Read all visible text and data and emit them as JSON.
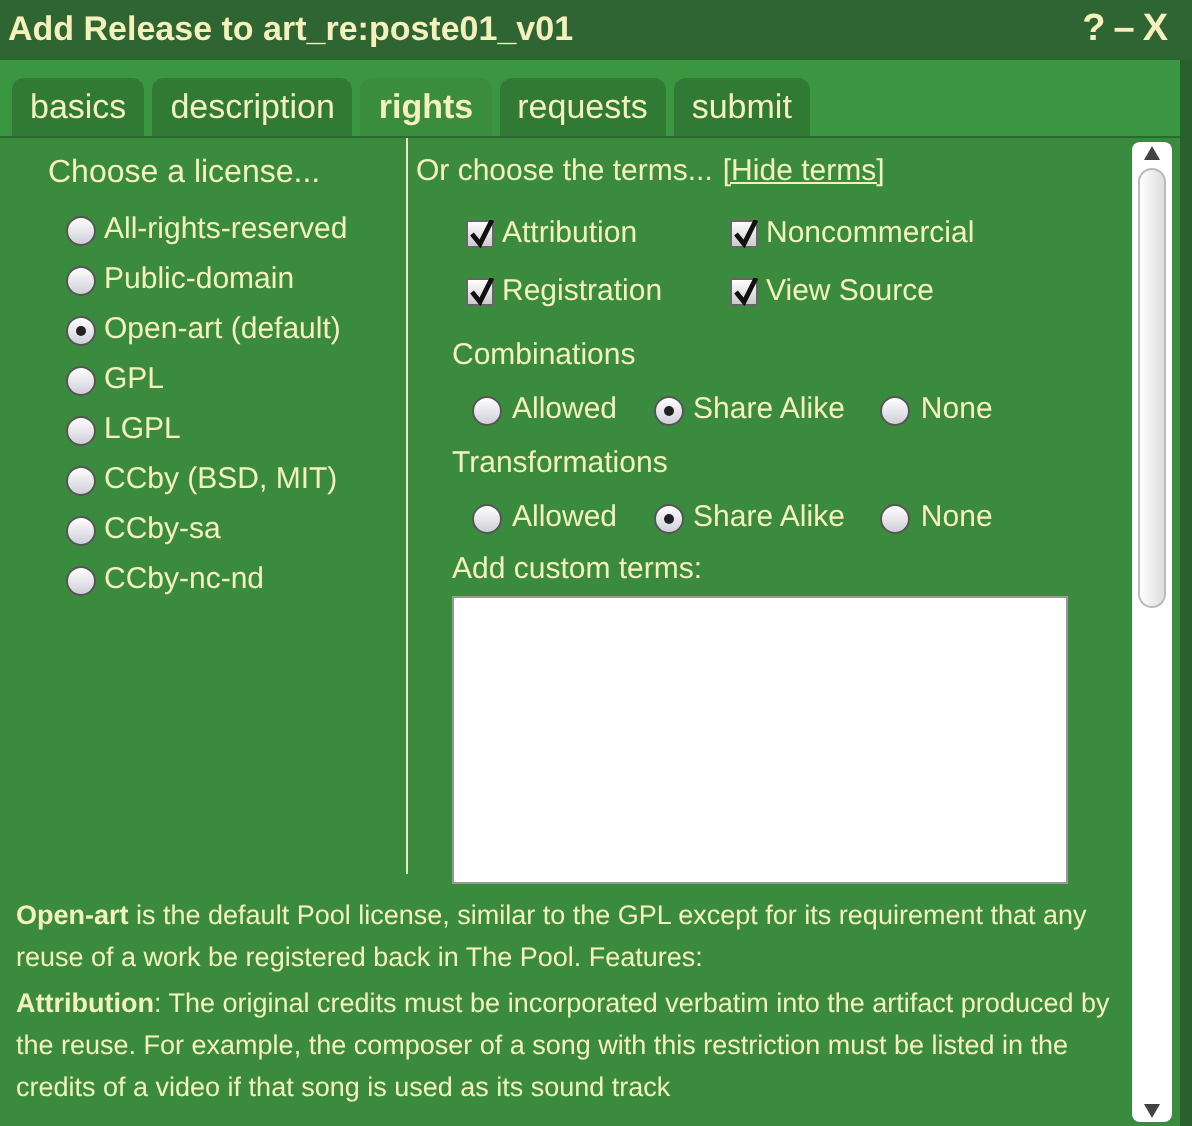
{
  "window": {
    "title": "Add Release to art_re:poste01_v01",
    "controls": [
      "?",
      "–",
      "X"
    ]
  },
  "tabs": [
    {
      "label": "basics",
      "selected": false
    },
    {
      "label": "description",
      "selected": false
    },
    {
      "label": "rights",
      "selected": true
    },
    {
      "label": "requests",
      "selected": false
    },
    {
      "label": "submit",
      "selected": false
    }
  ],
  "licenses": {
    "heading": "Choose a license...",
    "options": [
      {
        "label": "All-rights-reserved",
        "selected": false
      },
      {
        "label": "Public-domain",
        "selected": false
      },
      {
        "label": "Open-art (default)",
        "selected": true
      },
      {
        "label": "GPL",
        "selected": false
      },
      {
        "label": "LGPL",
        "selected": false
      },
      {
        "label": "CCby (BSD, MIT)",
        "selected": false
      },
      {
        "label": "CCby-sa",
        "selected": false
      },
      {
        "label": "CCby-nc-nd",
        "selected": false
      }
    ]
  },
  "terms": {
    "heading": "Or choose the terms...",
    "link": "[Hide terms]",
    "checkboxes": [
      {
        "label": "Attribution",
        "checked": true
      },
      {
        "label": "Noncommercial",
        "checked": true
      },
      {
        "label": "Registration",
        "checked": true
      },
      {
        "label": "View Source",
        "checked": true
      }
    ],
    "groups": [
      {
        "label": "Combinations",
        "options": [
          {
            "label": "Allowed",
            "selected": false
          },
          {
            "label": "Share Alike",
            "selected": true
          },
          {
            "label": "None",
            "selected": false
          }
        ]
      },
      {
        "label": "Transformations",
        "options": [
          {
            "label": "Allowed",
            "selected": false
          },
          {
            "label": "Share Alike",
            "selected": true
          },
          {
            "label": "None",
            "selected": false
          }
        ]
      }
    ],
    "custom_label": "Add custom terms:"
  },
  "description": [
    "**Open-art** is the default Pool license, similar to the GPL except for its requirement that any reuse of a work be registered back in The Pool. Features:",
    "**Attribution**: The original credits must be incorporated verbatim into the artifact produced by the reuse. For example, the composer of a song with this restriction must be listed in the credits of a video if that song is used as its sound track"
  ]
}
